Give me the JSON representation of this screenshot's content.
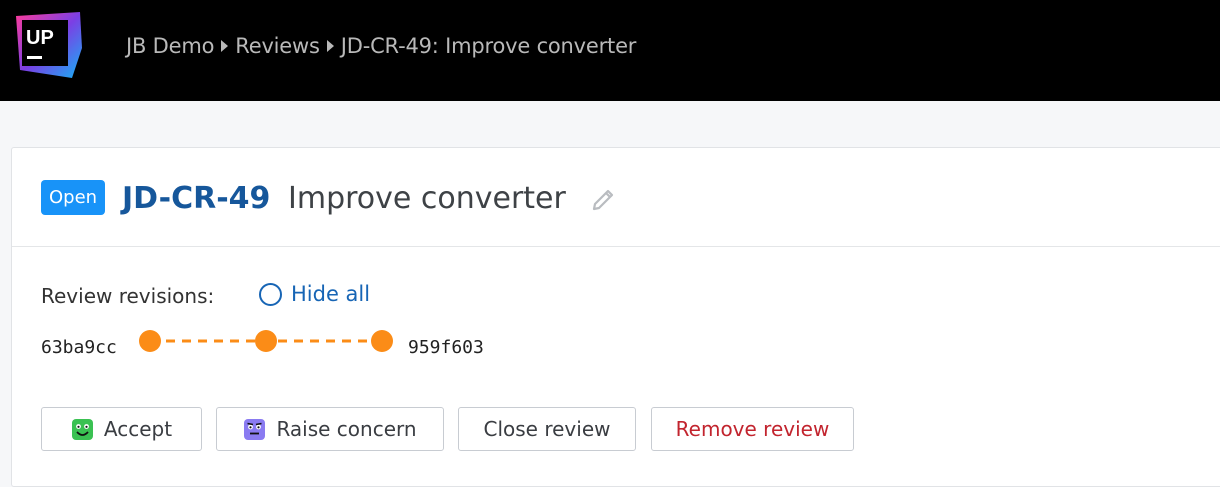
{
  "app": {
    "logo_text": "UP",
    "breadcrumb": [
      "JB Demo",
      "Reviews",
      "JD-CR-49: Improve converter"
    ]
  },
  "review": {
    "status": "Open",
    "id": "JD-CR-49",
    "title": "Improve converter"
  },
  "revisions": {
    "label": "Review revisions:",
    "hide_all_label": "Hide all",
    "from": "63ba9cc",
    "to": "959f603",
    "dot_count": 3
  },
  "actions": {
    "accept": "Accept",
    "raise_concern": "Raise concern",
    "close": "Close review",
    "remove": "Remove review"
  },
  "colors": {
    "status_badge": "#1893f8",
    "review_id": "#16579b",
    "timeline": "#fb8c17",
    "remove_text": "#c2242e",
    "accept_face": "#3ac152",
    "concern_face": "#8a7bf1"
  },
  "icons": [
    "upsource-logo",
    "chevron-right-icon",
    "pencil-icon",
    "radio-icon",
    "happy-face-icon",
    "concerned-face-icon"
  ]
}
